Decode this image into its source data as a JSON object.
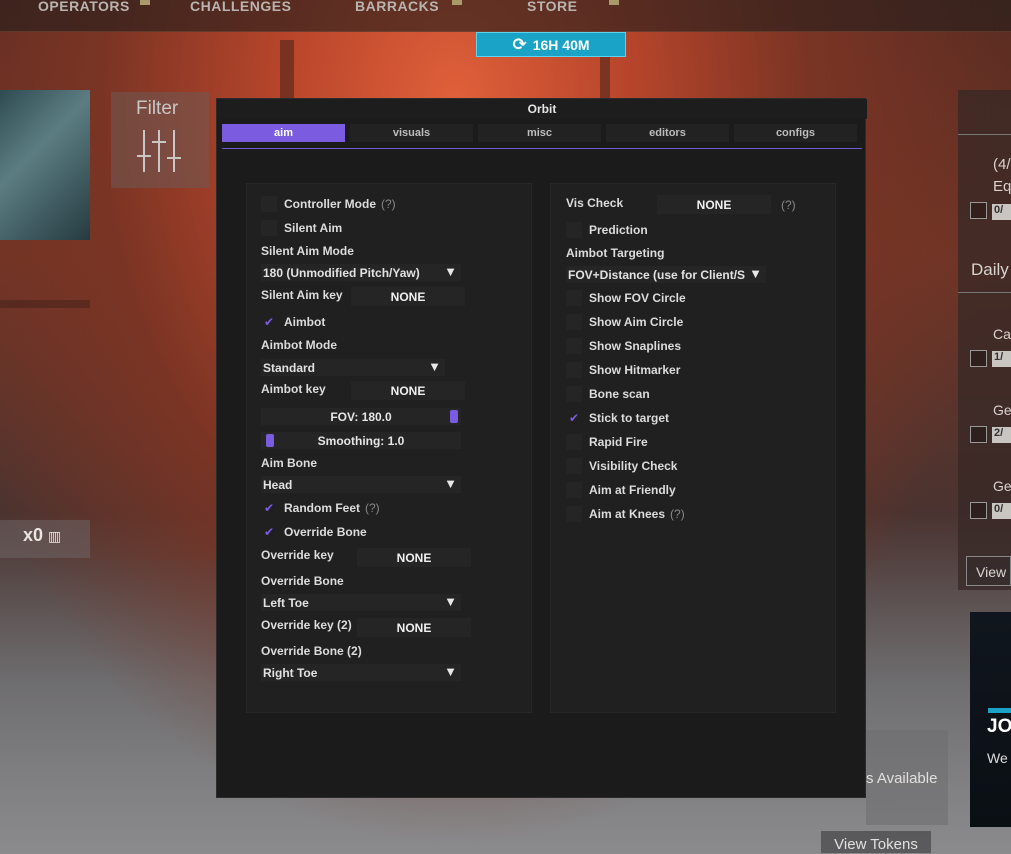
{
  "game": {
    "nav": [
      "OPERATORS",
      "CHALLENGES",
      "BARRACKS",
      "STORE"
    ],
    "timer": "16H 40M",
    "filter_label": "Filter",
    "tickets": "x0",
    "right_panel": {
      "count": "(4/",
      "equip": "Equ",
      "badge0": "0/",
      "daily": "Daily",
      "item1": "Cal",
      "badge1": "1/",
      "item2": "Ge",
      "badge2": "2/",
      "item3": "Ge",
      "badge3": "0/"
    },
    "view_button": "View C",
    "promo_title": "JO",
    "promo_sub": "We",
    "tokens_available": "s Available",
    "view_tokens": "View Tokens"
  },
  "menu": {
    "title": "Orbit",
    "tabs": [
      {
        "label": "aim",
        "active": true
      },
      {
        "label": "visuals",
        "active": false
      },
      {
        "label": "misc",
        "active": false
      },
      {
        "label": "editors",
        "active": false
      },
      {
        "label": "configs",
        "active": false
      }
    ],
    "accent_color": "#7b5ce0",
    "help_marker": "(?)",
    "check_glyph": "✔",
    "left": {
      "controller_mode": {
        "label": "Controller Mode",
        "checked": false
      },
      "silent_aim": {
        "label": "Silent Aim",
        "checked": false
      },
      "silent_aim_mode_label": "Silent Aim Mode",
      "silent_aim_mode_value": "180 (Unmodified Pitch/Yaw)",
      "silent_aim_key_label": "Silent Aim key",
      "silent_aim_key_value": "NONE",
      "aimbot": {
        "label": "Aimbot",
        "checked": true
      },
      "aimbot_mode_label": "Aimbot Mode",
      "aimbot_mode_value": "Standard",
      "aimbot_key_label": "Aimbot key",
      "aimbot_key_value": "NONE",
      "fov_slider": {
        "text": "FOV: 180.0",
        "value": 180.0,
        "max": 180.0
      },
      "smoothing_slider": {
        "text": "Smoothing: 1.0",
        "value": 1.0,
        "max": 100.0
      },
      "aim_bone_label": "Aim Bone",
      "aim_bone_value": "Head",
      "random_feet": {
        "label": "Random Feet",
        "checked": true
      },
      "override_bone": {
        "label": "Override Bone",
        "checked": true
      },
      "override_key_label": "Override key",
      "override_key_value": "NONE",
      "override_bone_label": "Override Bone",
      "override_bone_value": "Left Toe",
      "override_key2_label": "Override key (2)",
      "override_key2_value": "NONE",
      "override_bone2_label": "Override Bone (2)",
      "override_bone2_value": "Right Toe"
    },
    "right": {
      "vis_check_label": "Vis Check",
      "vis_check_value": "NONE",
      "prediction": {
        "label": "Prediction",
        "checked": false
      },
      "aimbot_targeting_label": "Aimbot Targeting",
      "aimbot_targeting_value": "FOV+Distance (use for Client/S",
      "show_fov_circle": {
        "label": "Show FOV Circle",
        "checked": false
      },
      "show_aim_circle": {
        "label": "Show Aim Circle",
        "checked": false
      },
      "show_snaplines": {
        "label": "Show Snaplines",
        "checked": false
      },
      "show_hitmarker": {
        "label": "Show Hitmarker",
        "checked": false
      },
      "bone_scan": {
        "label": "Bone scan",
        "checked": false
      },
      "stick_to_target": {
        "label": "Stick to target",
        "checked": true
      },
      "rapid_fire": {
        "label": "Rapid Fire",
        "checked": false
      },
      "visibility_check": {
        "label": "Visibility Check",
        "checked": false
      },
      "aim_at_friendly": {
        "label": "Aim at Friendly",
        "checked": false
      },
      "aim_at_knees": {
        "label": "Aim at Knees",
        "checked": false
      }
    }
  }
}
